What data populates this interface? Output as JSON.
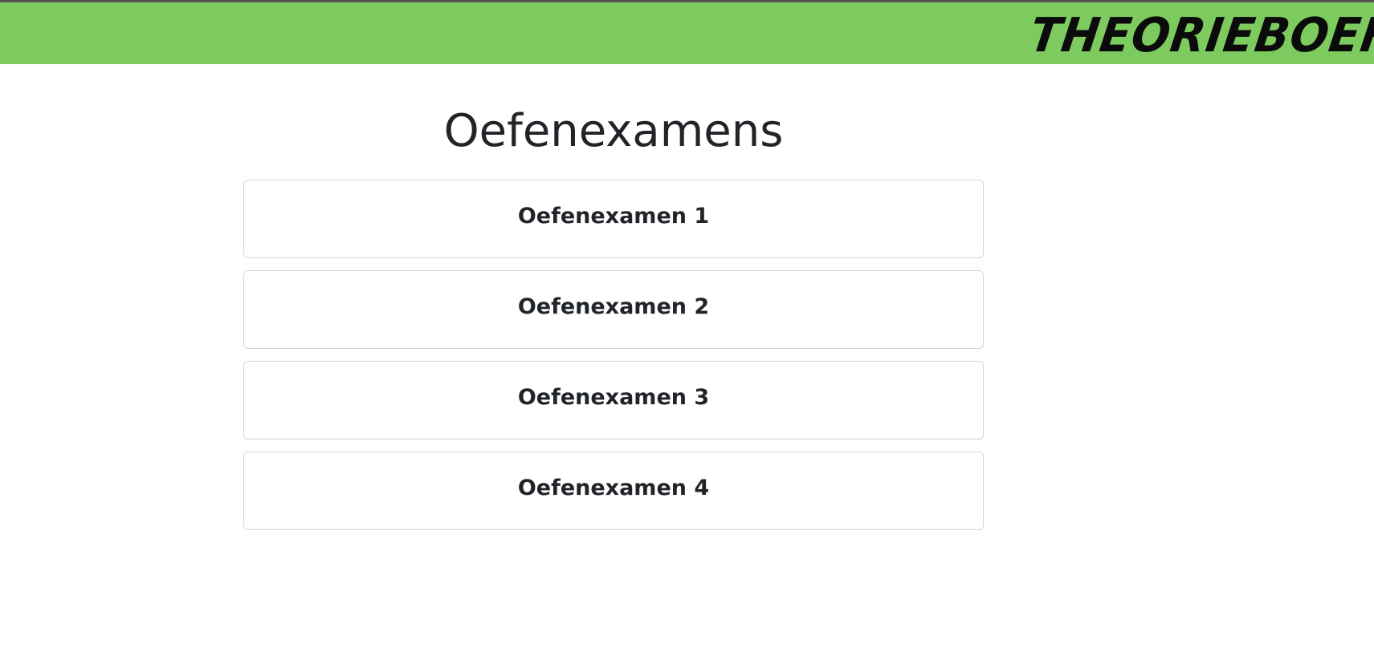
{
  "header": {
    "logo_text": "THEORIEBOEF",
    "bar_color": "#7dcb5f"
  },
  "main": {
    "title": "Oefenexamens",
    "exams": [
      {
        "label": "Oefenexamen 1"
      },
      {
        "label": "Oefenexamen 2"
      },
      {
        "label": "Oefenexamen 3"
      },
      {
        "label": "Oefenexamen 4"
      }
    ]
  }
}
